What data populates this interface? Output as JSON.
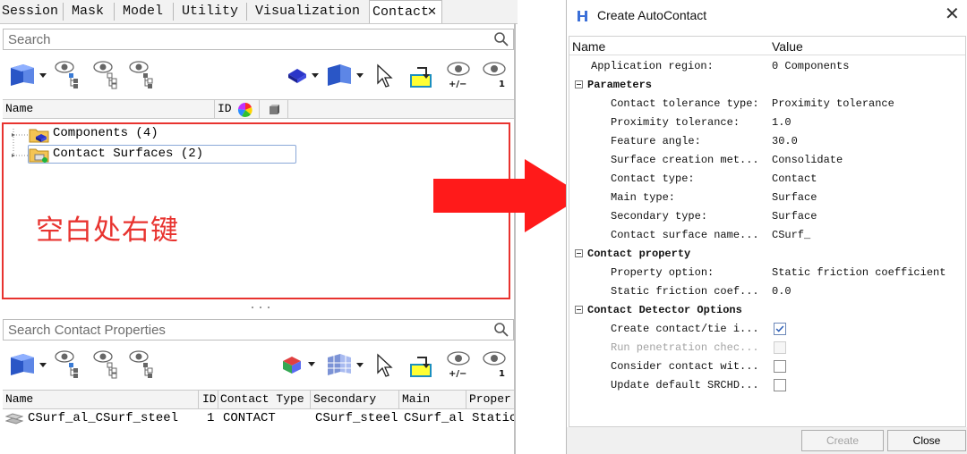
{
  "menubar": {
    "items": [
      "Session",
      "Mask",
      "Model",
      "Utility",
      "Visualization",
      "Contact"
    ],
    "active_tab": "Contact",
    "close_glyph": "✕"
  },
  "top_search": {
    "placeholder": "Search"
  },
  "tree_header": {
    "name": "Name",
    "id": "ID"
  },
  "tree": {
    "items": [
      "Components (4)",
      "Contact Surfaces (2)"
    ]
  },
  "annotation": {
    "text": "空白处右键",
    "color": "#e8332f"
  },
  "bottom_search": {
    "placeholder": "Search Contact Properties"
  },
  "toolbar": {
    "eye_labels": [
      "+/−",
      "1"
    ]
  },
  "contact_table": {
    "headers": [
      "Name",
      "ID",
      "Contact Type",
      "Secondary",
      "Main",
      "Proper"
    ],
    "rows": [
      {
        "name": "CSurf_al_CSurf_steel",
        "id": "1",
        "type": "CONTACT",
        "secondary": "CSurf_steel",
        "main": "CSurf_al",
        "property": "Static"
      }
    ]
  },
  "dialog": {
    "title": "Create AutoContact",
    "close_glyph": "✕",
    "columns": {
      "name": "Name",
      "value": "Value"
    },
    "application_region": {
      "name": "Application region:",
      "value": "0 Components"
    },
    "sections": [
      {
        "title": "Parameters",
        "rows": [
          {
            "name": "Contact tolerance type:",
            "value": "Proximity tolerance"
          },
          {
            "name": "Proximity tolerance:",
            "value": "1.0"
          },
          {
            "name": "Feature angle:",
            "value": "30.0"
          },
          {
            "name": "Surface creation met...",
            "value": "Consolidate"
          },
          {
            "name": "Contact type:",
            "value": "Contact"
          },
          {
            "name": "Main type:",
            "value": "Surface"
          },
          {
            "name": "Secondary type:",
            "value": "Surface"
          },
          {
            "name": "Contact surface name...",
            "value": "CSurf_"
          }
        ]
      },
      {
        "title": "Contact property",
        "rows": [
          {
            "name": "Property option:",
            "value": "Static friction coefficient"
          },
          {
            "name": "Static friction coef...",
            "value": "0.0"
          }
        ]
      },
      {
        "title": "Contact Detector Options",
        "rows": [
          {
            "name": "Create contact/tie i...",
            "checked": true,
            "disabled": false
          },
          {
            "name": "Run penetration chec...",
            "checked": false,
            "disabled": true
          },
          {
            "name": "Consider contact wit...",
            "checked": false,
            "disabled": false
          },
          {
            "name": "Update default SRCHD...",
            "checked": false,
            "disabled": false
          }
        ]
      }
    ],
    "buttons": {
      "create": "Create",
      "close": "Close"
    }
  },
  "colors": {
    "highlight_red": "#e8332f",
    "arrow_red": "#ff1a1a"
  }
}
